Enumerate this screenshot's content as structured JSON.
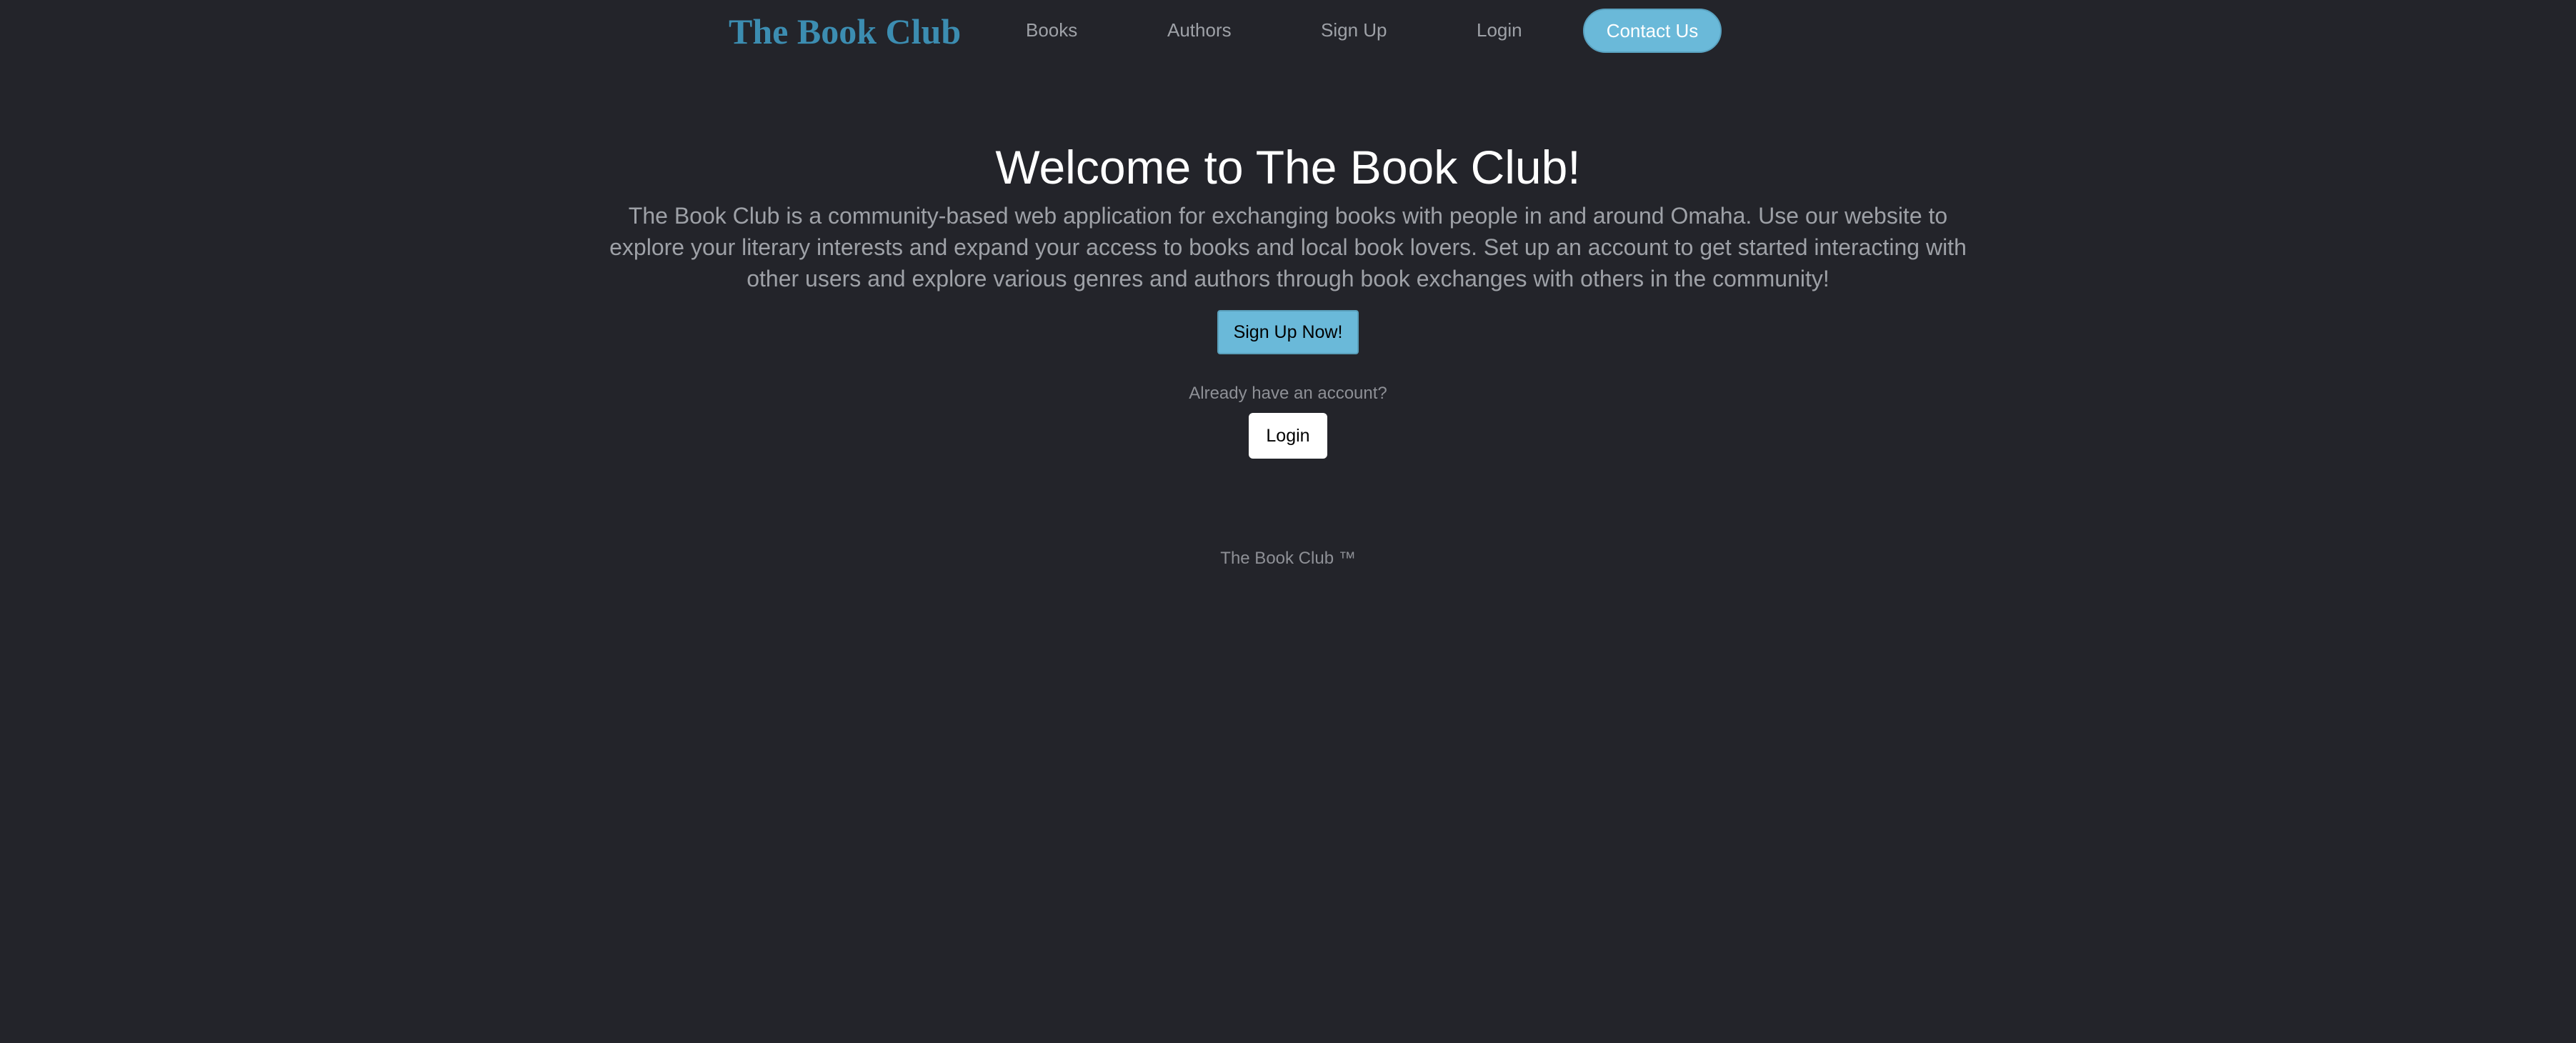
{
  "header": {
    "logo": "The Book Club",
    "nav": {
      "books": "Books",
      "authors": "Authors",
      "signup": "Sign Up",
      "login": "Login",
      "contact": "Contact Us"
    }
  },
  "hero": {
    "title": "Welcome to The Book Club!",
    "description": "The Book Club is a community-based web application for exchanging books with people in and around Omaha. Use our website to explore your literary interests and expand your access to books and local book lovers. Set up an account to get started interacting with other users and explore various genres and authors through book exchanges with others in the community!",
    "signup_button": "Sign Up Now!",
    "account_prompt": "Already have an account?",
    "login_button": "Login"
  },
  "footer": {
    "text": "The Book Club ™"
  },
  "colors": {
    "background": "#23242a",
    "brand": "#3c8db1",
    "accent": "#6ab9d9",
    "muted_text": "#9ea1a7"
  }
}
